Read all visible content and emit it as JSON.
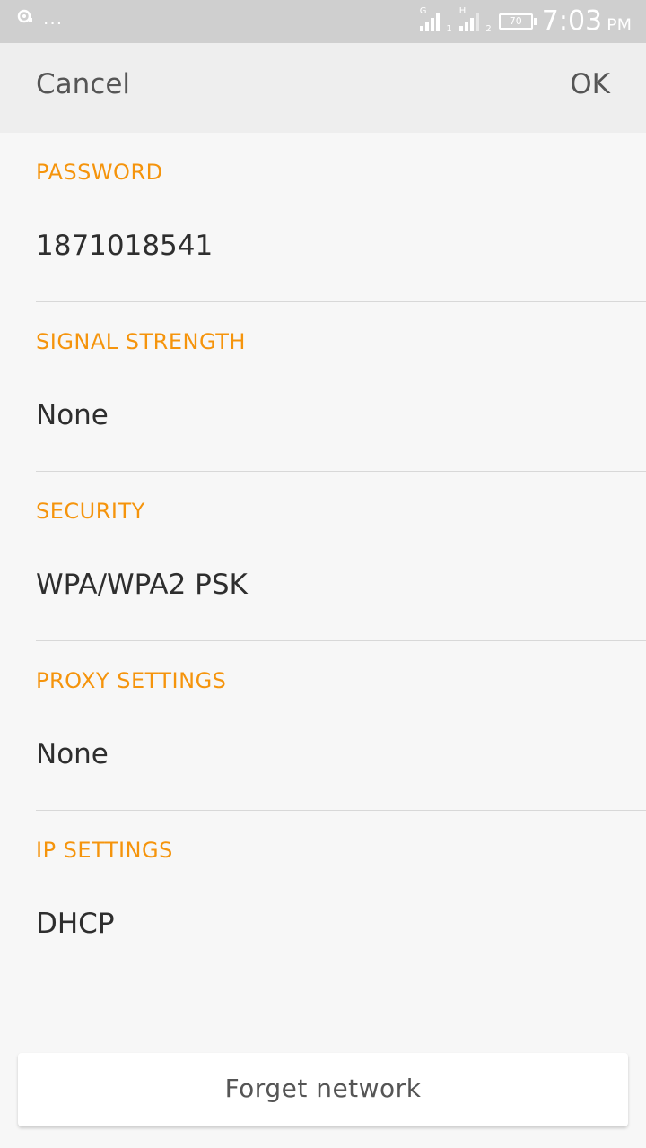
{
  "status_bar": {
    "left_dots": "...",
    "sim1": {
      "network": "G",
      "number": "1"
    },
    "sim2": {
      "network": "H",
      "number": "2"
    },
    "battery": "70",
    "time": "7:03",
    "ampm": "PM"
  },
  "header": {
    "cancel_label": "Cancel",
    "ok_label": "OK"
  },
  "sections": [
    {
      "label": "PASSWORD",
      "value": "1871018541"
    },
    {
      "label": "SIGNAL STRENGTH",
      "value": "None"
    },
    {
      "label": "SECURITY",
      "value": "WPA/WPA2 PSK"
    },
    {
      "label": "PROXY SETTINGS",
      "value": "None"
    },
    {
      "label": "IP SETTINGS",
      "value": "DHCP"
    }
  ],
  "forget_label": "Forget network",
  "colors": {
    "accent": "#f5940c",
    "status_bar": "#cfcfcf",
    "header_bg": "#eeeeee"
  },
  "icons": {
    "status_left": "notification-icon",
    "signal": "signal-bars-icon",
    "battery": "battery-icon"
  }
}
